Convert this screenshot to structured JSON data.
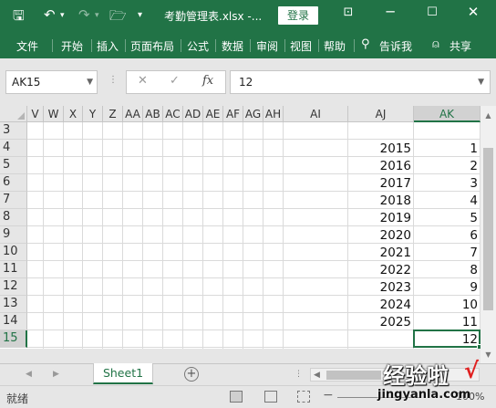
{
  "title_bar": {
    "save_icon": "save-icon",
    "undo_icon": "undo-icon",
    "redo_icon": "redo-icon",
    "folder_icon": "folder-icon",
    "customize_icon": "customize-quick-access-icon",
    "filename": "考勤管理表.xlsx  -...",
    "login_label": "登录",
    "ribbon_display_icon": "ribbon-display-icon",
    "minimize_icon": "minimize-icon",
    "maximize_icon": "maximize-icon",
    "close_icon": "close-icon",
    "accent_color": "#217346"
  },
  "ribbon_tabs": [
    {
      "label": "文件"
    },
    {
      "label": "开始"
    },
    {
      "label": "插入"
    },
    {
      "label": "页面布局"
    },
    {
      "label": "公式"
    },
    {
      "label": "数据"
    },
    {
      "label": "审阅"
    },
    {
      "label": "视图"
    },
    {
      "label": "帮助"
    }
  ],
  "tell_me": {
    "icon": "lightbulb-icon",
    "label": "告诉我"
  },
  "share": {
    "icon": "person-icon",
    "label": "共享"
  },
  "formula_bar": {
    "name_box": "AK15",
    "cancel_glyph": "✕",
    "enter_glyph": "✓",
    "fx_glyph": "fx",
    "content": "12"
  },
  "grid": {
    "columns": [
      "V",
      "W",
      "X",
      "Y",
      "Z",
      "AA",
      "AB",
      "AC",
      "AD",
      "AE",
      "AF",
      "AG",
      "AH",
      "AI",
      "AJ",
      "AK"
    ],
    "selected_column": "AK",
    "rows": [
      {
        "num": "3",
        "aj": "",
        "ak": ""
      },
      {
        "num": "4",
        "aj": "2015",
        "ak": "1"
      },
      {
        "num": "5",
        "aj": "2016",
        "ak": "2"
      },
      {
        "num": "6",
        "aj": "2017",
        "ak": "3"
      },
      {
        "num": "7",
        "aj": "2018",
        "ak": "4"
      },
      {
        "num": "8",
        "aj": "2019",
        "ak": "5"
      },
      {
        "num": "9",
        "aj": "2020",
        "ak": "6"
      },
      {
        "num": "10",
        "aj": "2021",
        "ak": "7"
      },
      {
        "num": "11",
        "aj": "2022",
        "ak": "8"
      },
      {
        "num": "12",
        "aj": "2023",
        "ak": "9"
      },
      {
        "num": "13",
        "aj": "2024",
        "ak": "10"
      },
      {
        "num": "14",
        "aj": "2025",
        "ak": "11"
      },
      {
        "num": "15",
        "aj": "",
        "ak": "12"
      }
    ],
    "selected_row": "15"
  },
  "sheet_tabs": [
    {
      "label": "Sheet1"
    }
  ],
  "status_bar": {
    "ready": "就绪",
    "zoom": "100%"
  },
  "watermark": {
    "main": "经验啦",
    "check": "√",
    "url": "jingyanla.com"
  }
}
